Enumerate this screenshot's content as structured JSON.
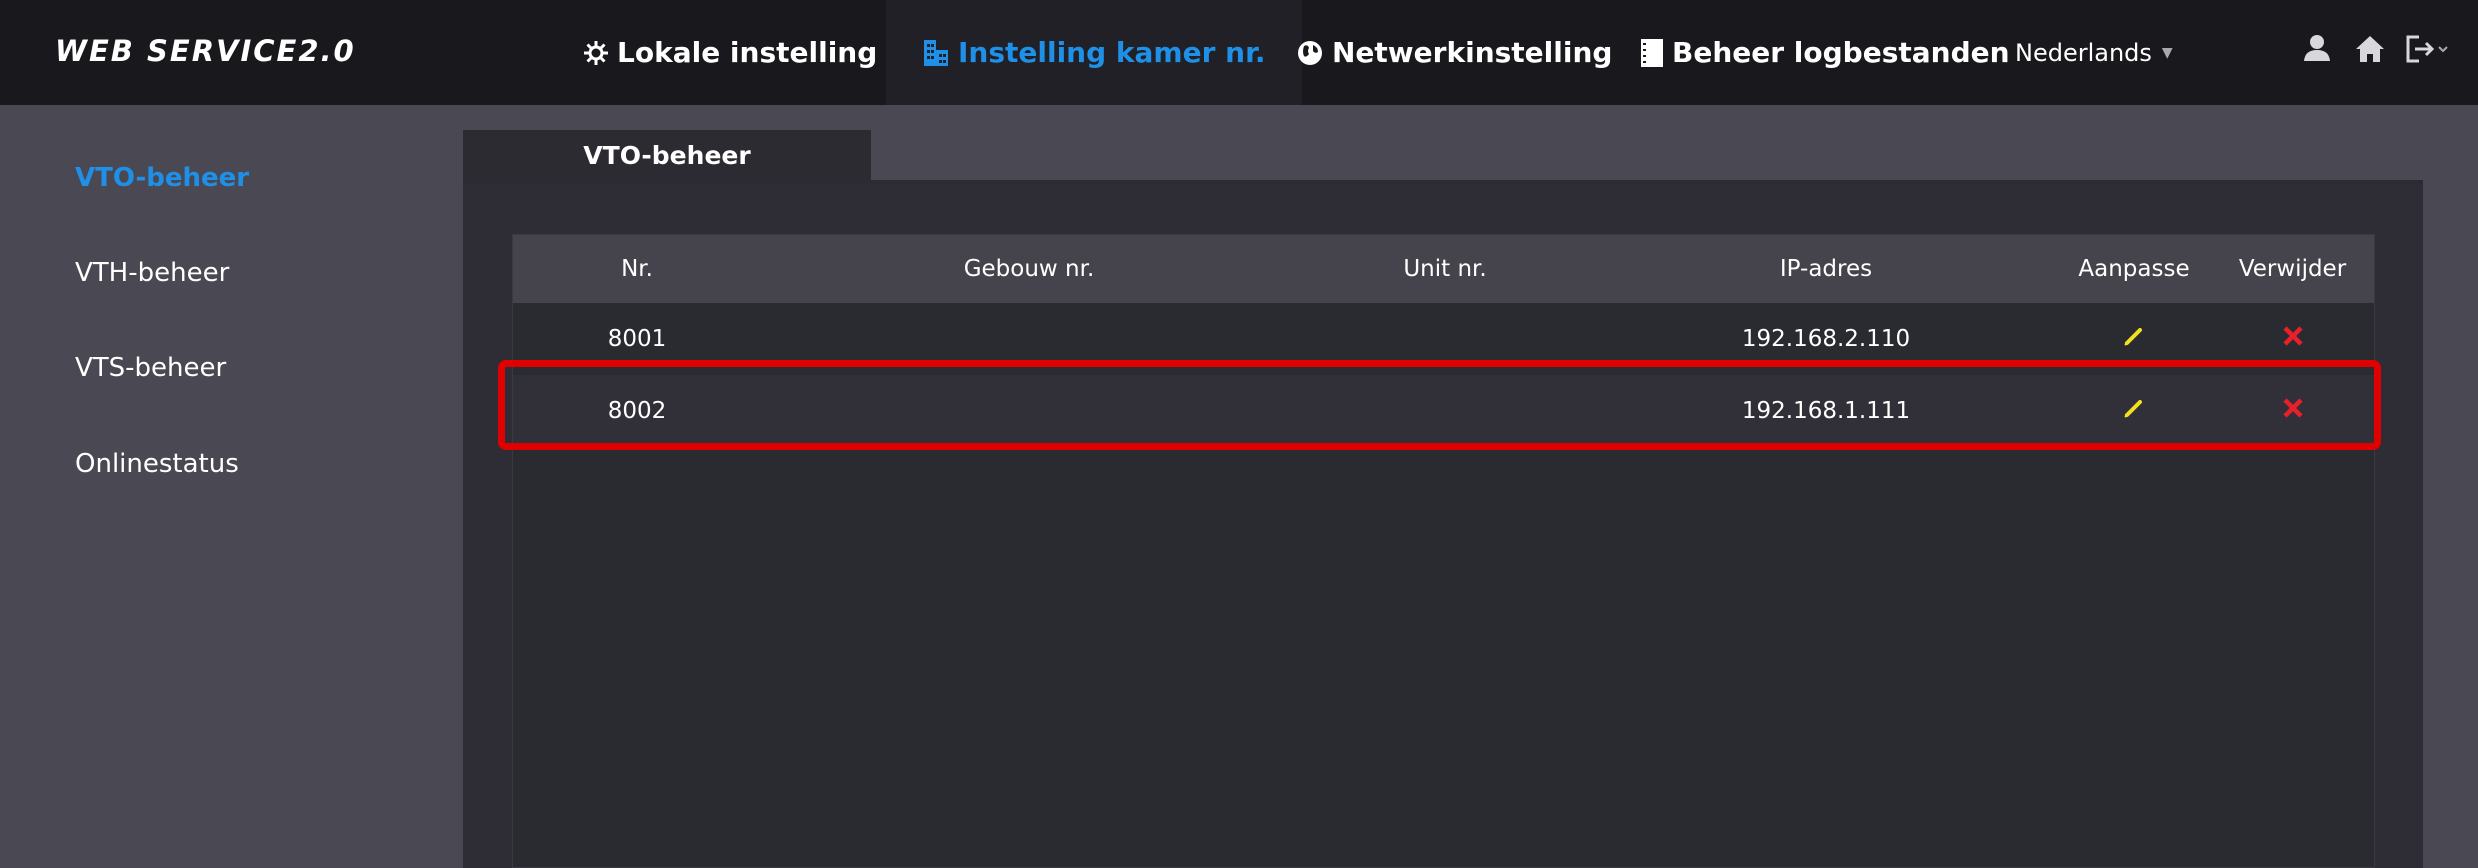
{
  "app": {
    "logo": "WEB SERVICE2.0"
  },
  "topnav": [
    {
      "label": "Lokale instelling",
      "icon": "gear-icon"
    },
    {
      "label": "Instelling kamer nr.",
      "icon": "building-icon",
      "active": true
    },
    {
      "label": "Netwerkinstelling",
      "icon": "globe-icon"
    },
    {
      "label": "Beheer logbestanden",
      "icon": "log-icon"
    }
  ],
  "language": {
    "selected": "Nederlands"
  },
  "toolbar_icons": [
    "user-icon",
    "home-icon",
    "logout-icon"
  ],
  "sidebar": {
    "items": [
      {
        "label": "VTO-beheer",
        "active": true
      },
      {
        "label": "VTH-beheer"
      },
      {
        "label": "VTS-beheer"
      },
      {
        "label": "Onlinestatus"
      }
    ]
  },
  "tab": {
    "label": "VTO-beheer"
  },
  "table": {
    "headers": [
      "Nr.",
      "Gebouw nr.",
      "Unit nr.",
      "IP-adres",
      "Aanpasse",
      "Verwijder"
    ],
    "rows": [
      {
        "nr": "8001",
        "gebouw": "",
        "unit": "",
        "ip": "192.168.2.110"
      },
      {
        "nr": "8002",
        "gebouw": "",
        "unit": "",
        "ip": "192.168.1.111"
      }
    ]
  },
  "colors": {
    "accent": "#1e90e8",
    "edit_icon": "#f0e020",
    "delete_icon": "#e8202a",
    "highlight": "#e10000"
  }
}
